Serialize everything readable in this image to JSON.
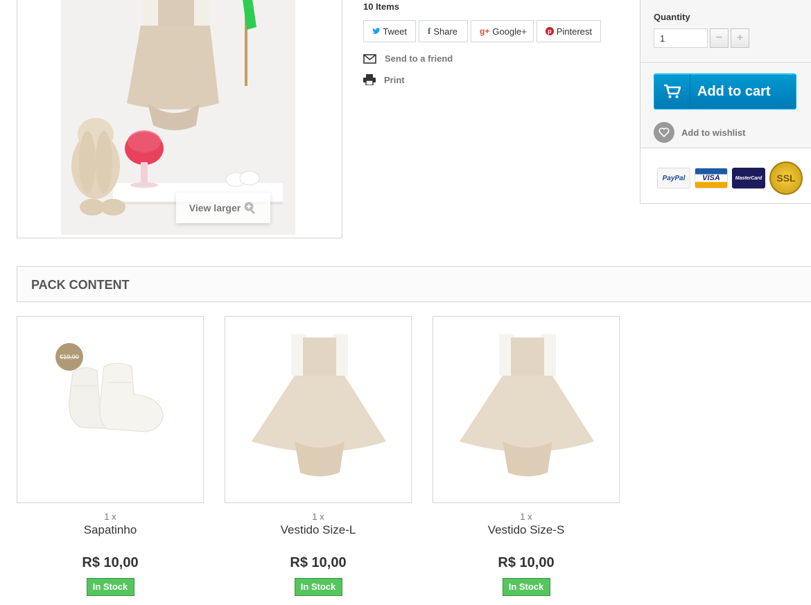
{
  "main_image": {
    "view_larger_label": "View larger",
    "alt": "Dress with bunny and shoes"
  },
  "info": {
    "items_count": "10 Items",
    "social": [
      {
        "label": "Tweet",
        "icon": "twitter-icon"
      },
      {
        "label": "Share",
        "icon": "facebook-icon"
      },
      {
        "label": "Google+",
        "icon": "google-plus-icon"
      },
      {
        "label": "Pinterest",
        "icon": "pinterest-icon"
      }
    ],
    "send_to_friend": "Send to a friend",
    "print": "Print"
  },
  "buy": {
    "quantity_label": "Quantity",
    "quantity_value": "1",
    "add_to_cart": "Add to cart",
    "add_to_wishlist": "Add to wishlist",
    "payment_cards": [
      "PayPal",
      "VISA",
      "MasterCard",
      "SSL"
    ]
  },
  "pack": {
    "title": "Pack content",
    "products": [
      {
        "qty": "1 x",
        "name": "Sapatinho",
        "price": "R$ 10,00",
        "stock": "In Stock",
        "old_price": "€19,90"
      },
      {
        "qty": "1 x",
        "name": "Vestido Size-L",
        "price": "R$ 10,00",
        "stock": "In Stock"
      },
      {
        "qty": "1 x",
        "name": "Vestido Size-S",
        "price": "R$ 10,00",
        "stock": "In Stock"
      }
    ]
  },
  "colors": {
    "accent_blue": "#0079b6",
    "stock_green": "#55c65e",
    "border": "#d6d4d4"
  }
}
